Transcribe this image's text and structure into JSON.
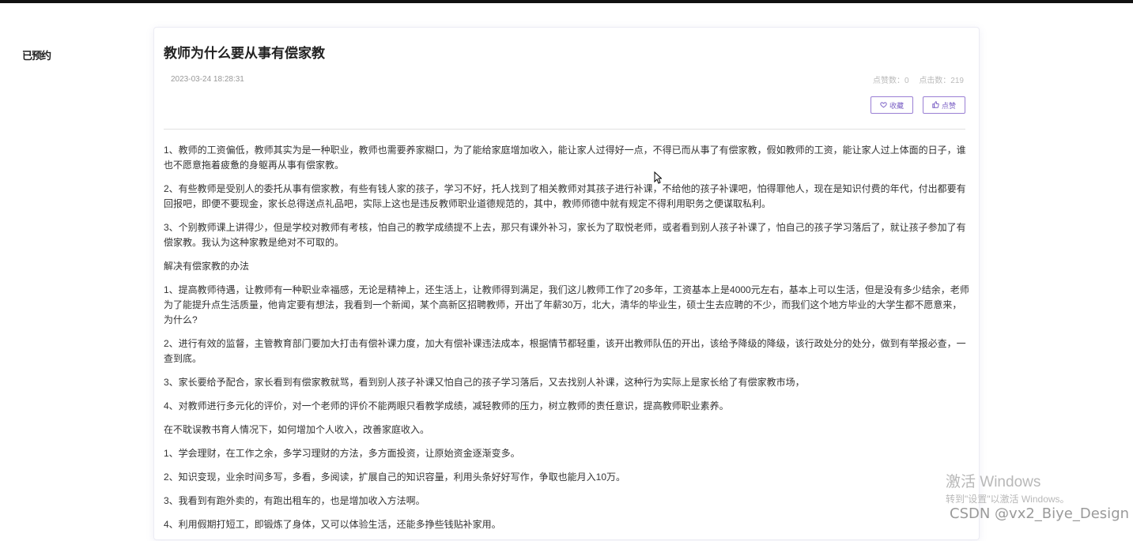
{
  "sidebar": {
    "label": "已预约"
  },
  "article": {
    "title": "教师为什么要从事有偿家教",
    "date": "2023-03-24 18:28:31",
    "likes_label": "点赞数：0",
    "clicks_label": "点击数：219",
    "favorite_button": "收藏",
    "like_button": "点赞",
    "paragraphs": [
      "1、教师的工资偏低，教师其实为是一种职业，教师也需要养家糊口，为了能给家庭增加收入，能让家人过得好一点，不得已而从事了有偿家教，假如教师的工资，能让家人过上体面的日子，谁也不愿意拖着疲惫的身躯再从事有偿家教。",
      "2、有些教师是受别人的委托从事有偿家教，有些有钱人家的孩子，学习不好，托人找到了相关教师对其孩子进行补课，不给他的孩子补课吧，怕得罪他人，现在是知识付费的年代，付出都要有回报吧，即便不要现金，家长总得送点礼品吧，实际上这也是违反教师职业道德规范的，其中，教师师德中就有规定不得利用职务之便谋取私利。",
      "3、个别教师课上讲得少，但是学校对教师有考核，怕自己的教学成绩提不上去，那只有课外补习，家长为了取悦老师，或者看到别人孩子补课了，怕自己的孩子学习落后了，就让孩子参加了有偿家教。我认为这种家教是绝对不可取的。",
      "解决有偿家教的办法",
      "1、提高教师待遇，让教师有一种职业幸福感，无论是精神上，还生活上，让教师得到满足，我们这儿教师工作了20多年，工资基本上是4000元左右，基本上可以生活，但是没有多少结余，老师为了能提升点生活质量，他肯定要有想法，我看到一个新闻，某个高新区招聘教师，开出了年薪30万，北大，清华的毕业生，硕士生去应聘的不少，而我们这个地方毕业的大学生都不愿意来，为什么?",
      "2、进行有效的监督，主管教育部门要加大打击有偿补课力度，加大有偿补课违法成本，根据情节都轻重，该开出教师队伍的开出，该给予降级的降级，该行政处分的处分，做到有举报必查，一查到底。",
      "3、家长要给予配合，家长看到有偿家教就骂，看到别人孩子补课又怕自己的孩子学习落后，又去找别人补课，这种行为实际上是家长给了有偿家教市场，",
      "4、对教师进行多元化的评价，对一个老师的评价不能两眼只看教学成绩，减轻教师的压力，树立教师的责任意识，提高教师职业素养。",
      "在不耽误教书育人情况下，如何增加个人收入，改善家庭收入。",
      "1、学会理财，在工作之余，多学习理财的方法，多方面投资，让原始资金逐渐变多。",
      "2、知识变现，业余时间多写，多看，多阅读，扩展自己的知识容量，利用头条好好写作，争取也能月入10万。",
      "3、我看到有跑外卖的，有跑出租车的，也是增加收入方法啊。",
      "4、利用假期打短工，即锻炼了身体，又可以体验生活，还能多挣些钱贴补家用。"
    ]
  },
  "overlay": {
    "windows_title": "激活 Windows",
    "windows_sub": "转到\"设置\"以激活 Windows。",
    "csdn": "CSDN @vx2_Biye_Design"
  },
  "colors": {
    "accent": "#7a5fc4",
    "text": "#333333",
    "muted": "#999999"
  }
}
